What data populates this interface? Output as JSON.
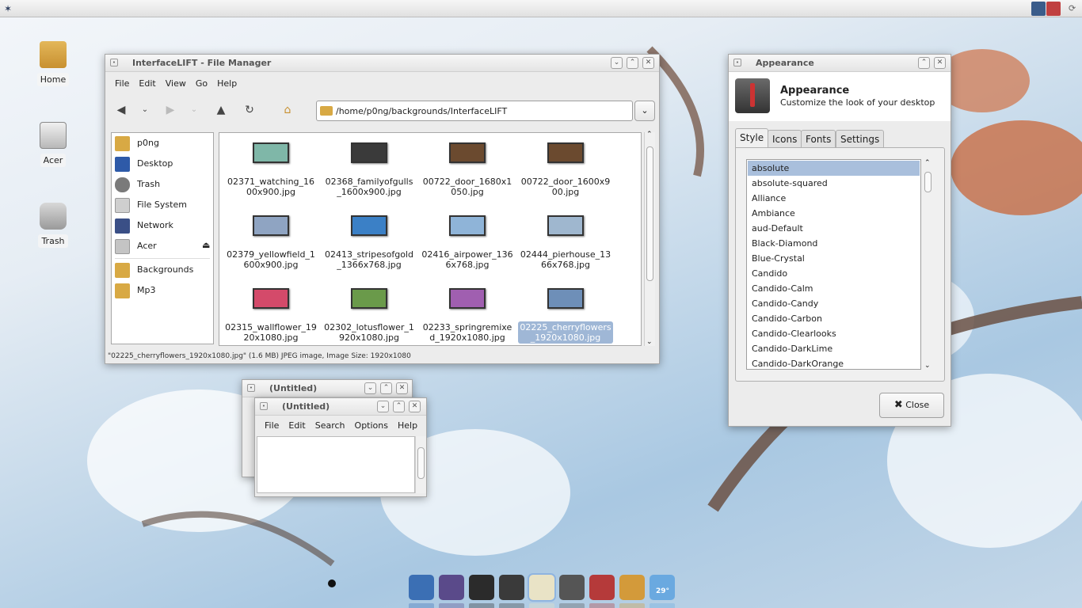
{
  "desktop": {
    "icons": [
      {
        "label": "Home"
      },
      {
        "label": "Acer"
      },
      {
        "label": "Trash"
      }
    ]
  },
  "topbar": {
    "icon": "mouse-icon"
  },
  "file_manager": {
    "title": "InterfaceLIFT - File Manager",
    "menu": [
      "File",
      "Edit",
      "View",
      "Go",
      "Help"
    ],
    "path": "/home/p0ng/backgrounds/InterfaceLIFT",
    "sidebar": [
      {
        "label": "p0ng",
        "icon": "home-folder-icon",
        "color": "#d8a944"
      },
      {
        "label": "Desktop",
        "icon": "desktop-icon",
        "color": "#2e5aa8"
      },
      {
        "label": "Trash",
        "icon": "trash-icon",
        "color": "#7a7a7a"
      },
      {
        "label": "File System",
        "icon": "harddisk-icon",
        "color": "#cfcfcf"
      },
      {
        "label": "Network",
        "icon": "network-icon",
        "color": "#3a4f86"
      },
      {
        "label": "Acer",
        "icon": "drive-icon",
        "color": "#c4c4c4"
      },
      {
        "label": "Backgrounds",
        "icon": "folder-icon",
        "color": "#d8a944"
      },
      {
        "label": "Mp3",
        "icon": "folder-icon",
        "color": "#d8a944"
      }
    ],
    "files": [
      {
        "name": "02371_watching_1600x900.jpg",
        "color": "#7fb7a8"
      },
      {
        "name": "02368_familyofgulls_1600x900.jpg",
        "color": "#3a3a3a"
      },
      {
        "name": "00722_door_1680x1050.jpg",
        "color": "#6b4a2f"
      },
      {
        "name": "00722_door_1600x900.jpg",
        "color": "#6b4a2f"
      },
      {
        "name": "02379_yellowfield_1600x900.jpg",
        "color": "#8fa4c2"
      },
      {
        "name": "02413_stripesofgold_1366x768.jpg",
        "color": "#3b80c6"
      },
      {
        "name": "02416_airpower_1366x768.jpg",
        "color": "#8fb4d8"
      },
      {
        "name": "02444_pierhouse_1366x768.jpg",
        "color": "#9fb7cf"
      },
      {
        "name": "02315_wallflower_1920x1080.jpg",
        "color": "#d44a6a"
      },
      {
        "name": "02302_lotusflower_1920x1080.jpg",
        "color": "#6a9a4a"
      },
      {
        "name": "02233_springremixed_1920x1080.jpg",
        "color": "#a05fb0"
      },
      {
        "name": "02225_cherryflowers_1920x1080.jpg",
        "color": "#6e8fb8",
        "selected": true
      }
    ],
    "status": "\"02225_cherryflowers_1920x1080.jpg\" (1.6 MB) JPEG image, Image Size: 1920x1080"
  },
  "editor_back": {
    "title": "(Untitled)"
  },
  "editor_front": {
    "title": "(Untitled)",
    "menu": [
      "File",
      "Edit",
      "Search",
      "Options",
      "Help"
    ]
  },
  "appearance": {
    "title": "Appearance",
    "header": "Appearance",
    "subtitle": "Customize the look of your desktop",
    "tabs": [
      "Style",
      "Icons",
      "Fonts",
      "Settings"
    ],
    "styles": [
      "absolute",
      "absolute-squared",
      "Alliance",
      "Ambiance",
      "aud-Default",
      "Black-Diamond",
      "Blue-Crystal",
      "Candido",
      "Candido-Calm",
      "Candido-Candy",
      "Candido-Carbon",
      "Candido-Clearlooks",
      "Candido-DarkLime",
      "Candido-DarkOrange"
    ],
    "close_label": "Close"
  },
  "dock": [
    {
      "icon": "browser-icon",
      "color": "#3b6fb4"
    },
    {
      "icon": "pidgin-icon",
      "color": "#5a4a8a"
    },
    {
      "icon": "terminal-icon",
      "color": "#2b2b2b"
    },
    {
      "icon": "audacious-icon",
      "color": "#3a3a3a"
    },
    {
      "icon": "text-editor-icon",
      "color": "#e9e3c6"
    },
    {
      "icon": "appearance-icon",
      "color": "#555555"
    },
    {
      "icon": "synaptic-icon",
      "color": "#b53a3a"
    },
    {
      "icon": "graphics-icon",
      "color": "#d39a3a"
    },
    {
      "icon": "weather-icon",
      "color": "#6aa9e0",
      "label": "29°"
    }
  ],
  "colors": {
    "selection": "#a9bfdc",
    "accent": "#d8a944"
  }
}
